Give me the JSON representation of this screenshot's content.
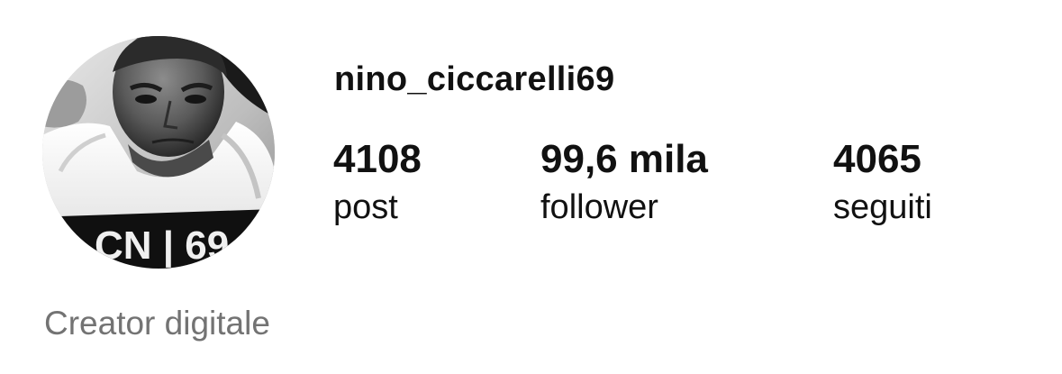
{
  "profile": {
    "username": "nino_ciccarelli69",
    "avatar_icon": "profile-photo",
    "avatar_shirt_text": "CN | 69",
    "category": "Creator digitale"
  },
  "stats": {
    "posts": {
      "value": "4108",
      "label": "post"
    },
    "followers": {
      "value": "99,6 mila",
      "label": "follower"
    },
    "following": {
      "value": "4065",
      "label": "seguiti"
    }
  },
  "colors": {
    "text_primary": "#111111",
    "text_secondary": "#737373",
    "background": "#ffffff"
  }
}
